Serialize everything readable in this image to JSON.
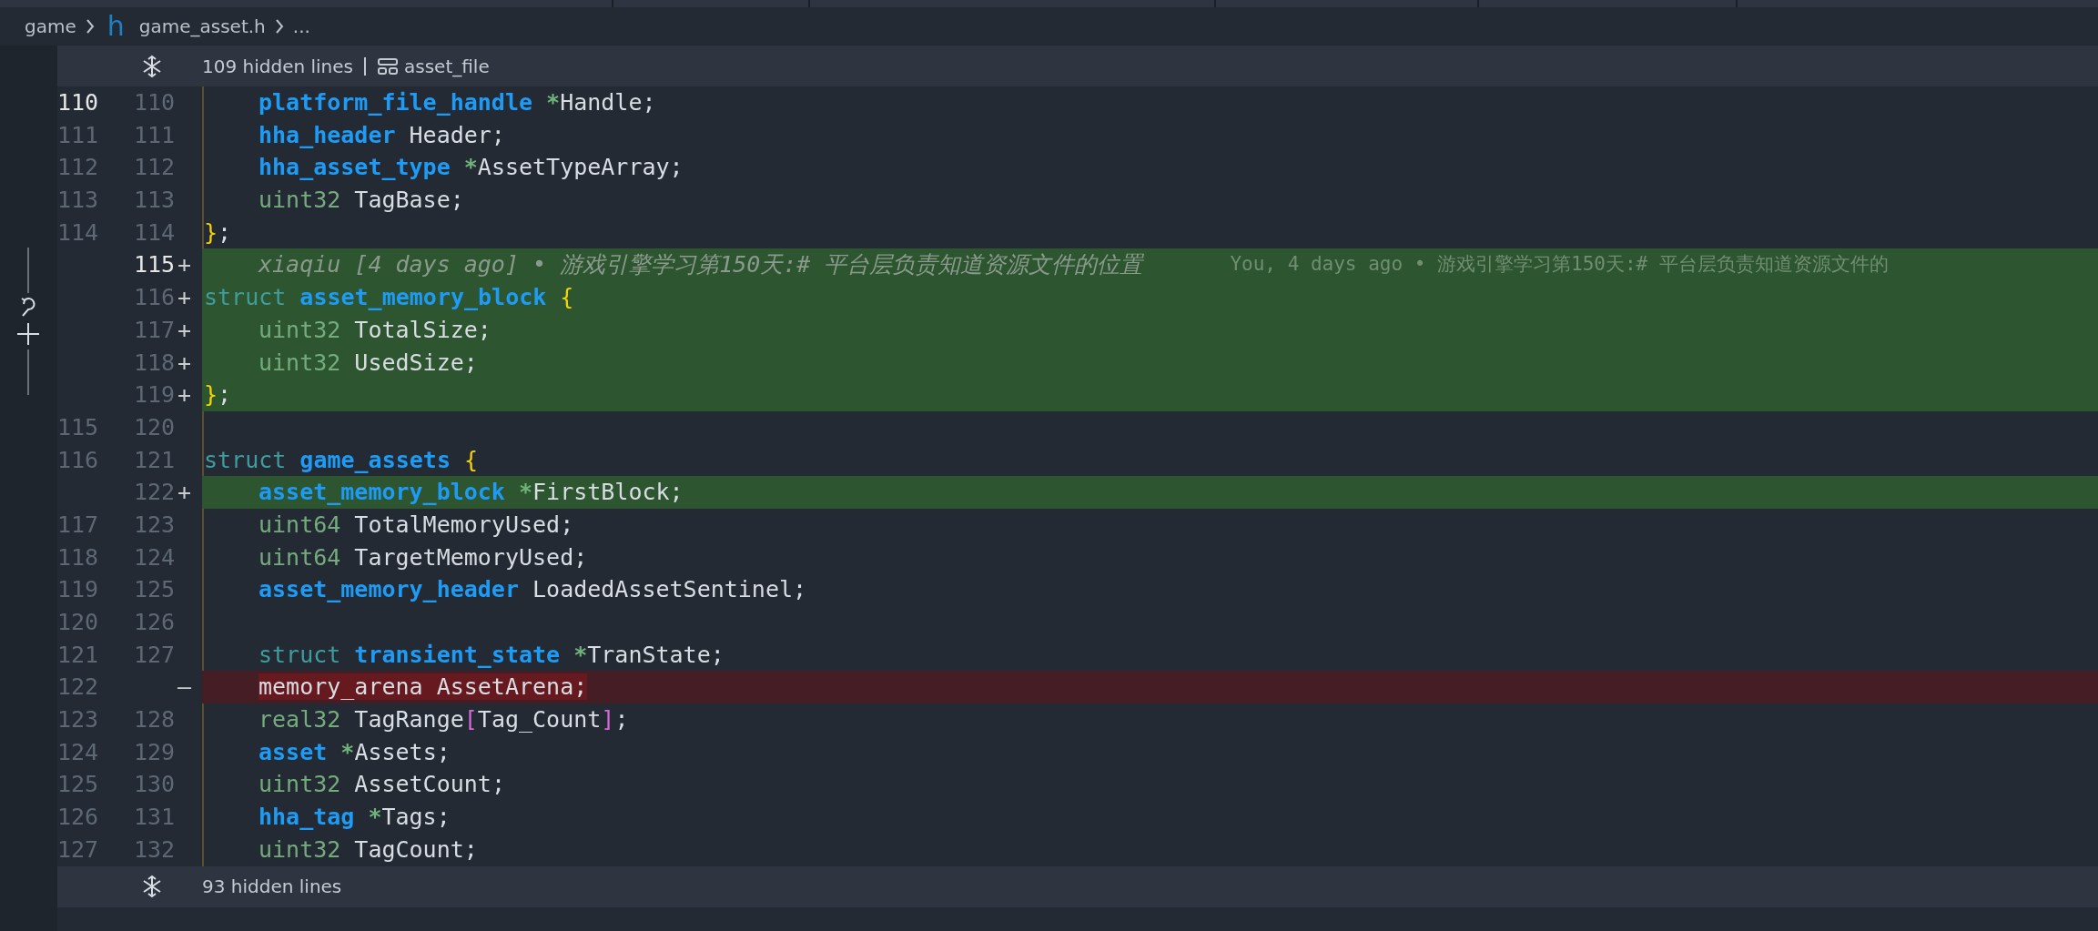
{
  "breadcrumb": {
    "folder": "game",
    "file_icon": "h",
    "file": "game_asset.h",
    "more": "..."
  },
  "top_fold": {
    "label": "109 hidden lines",
    "symbol": "asset_file"
  },
  "rows": [
    {
      "kind": "context",
      "old": "110",
      "new": "110",
      "current": true,
      "indented": true,
      "tokens": [
        {
          "kind": "ty",
          "t": "platform_file_handle"
        },
        {
          "kind": "ptr",
          "t": " *"
        },
        {
          "kind": "id",
          "t": "Handle;"
        }
      ]
    },
    {
      "kind": "context",
      "old": "111",
      "new": "111",
      "indented": true,
      "tokens": [
        {
          "kind": "ty",
          "t": "hha_header"
        },
        {
          "kind": "id",
          "t": " Header;"
        }
      ]
    },
    {
      "kind": "context",
      "old": "112",
      "new": "112",
      "indented": true,
      "tokens": [
        {
          "kind": "ty",
          "t": "hha_asset_type"
        },
        {
          "kind": "ptr",
          "t": " *"
        },
        {
          "kind": "id",
          "t": "AssetTypeArray;"
        }
      ]
    },
    {
      "kind": "context",
      "old": "113",
      "new": "113",
      "indented": true,
      "tokens": [
        {
          "kind": "prim",
          "t": "uint32"
        },
        {
          "kind": "id",
          "t": " TagBase;"
        }
      ]
    },
    {
      "kind": "context",
      "old": "114",
      "new": "114",
      "indented": false,
      "tokens": [
        {
          "kind": "brace",
          "t": "}"
        },
        {
          "kind": "id",
          "t": ";"
        }
      ]
    },
    {
      "kind": "added",
      "new": "115",
      "marker": "+",
      "current": true,
      "indented": true,
      "annotation": "xiaqiu [4 days ago] • 游戏引擎学习第150天:# 平台层负责知道资源文件的位置",
      "blame": "You, 4 days ago • 游戏引擎学习第150天:# 平台层负责知道资源文件的"
    },
    {
      "kind": "added",
      "new": "116",
      "marker": "+",
      "indented": false,
      "tokens": [
        {
          "kind": "kw",
          "t": "struct"
        },
        {
          "kind": "ty",
          "t": " asset_memory_block"
        },
        {
          "kind": "brace",
          "t": " {"
        }
      ]
    },
    {
      "kind": "added",
      "new": "117",
      "marker": "+",
      "indented": true,
      "tokens": [
        {
          "kind": "prim",
          "t": "uint32"
        },
        {
          "kind": "id",
          "t": " TotalSize;"
        }
      ]
    },
    {
      "kind": "added",
      "new": "118",
      "marker": "+",
      "indented": true,
      "tokens": [
        {
          "kind": "prim",
          "t": "uint32"
        },
        {
          "kind": "id",
          "t": " UsedSize;"
        }
      ]
    },
    {
      "kind": "added",
      "new": "119",
      "marker": "+",
      "indented": false,
      "tokens": [
        {
          "kind": "brace",
          "t": "}"
        },
        {
          "kind": "id",
          "t": ";"
        }
      ]
    },
    {
      "kind": "context",
      "old": "115",
      "new": "120"
    },
    {
      "kind": "context",
      "old": "116",
      "new": "121",
      "indented": false,
      "tokens": [
        {
          "kind": "kw",
          "t": "struct"
        },
        {
          "kind": "ty",
          "t": " game_assets"
        },
        {
          "kind": "brace",
          "t": " {"
        }
      ]
    },
    {
      "kind": "added",
      "new": "122",
      "marker": "+",
      "indented": true,
      "tokens": [
        {
          "kind": "ty",
          "t": "asset_memory_block"
        },
        {
          "kind": "ptr",
          "t": " *"
        },
        {
          "kind": "id",
          "t": "FirstBlock;"
        }
      ]
    },
    {
      "kind": "context",
      "old": "117",
      "new": "123",
      "indented": true,
      "tokens": [
        {
          "kind": "prim",
          "t": "uint64"
        },
        {
          "kind": "id",
          "t": " TotalMemoryUsed;"
        }
      ]
    },
    {
      "kind": "context",
      "old": "118",
      "new": "124",
      "indented": true,
      "tokens": [
        {
          "kind": "prim",
          "t": "uint64"
        },
        {
          "kind": "id",
          "t": " TargetMemoryUsed;"
        }
      ]
    },
    {
      "kind": "context",
      "old": "119",
      "new": "125",
      "indented": true,
      "tokens": [
        {
          "kind": "ty",
          "t": "asset_memory_header"
        },
        {
          "kind": "id",
          "t": " LoadedAssetSentinel;"
        }
      ]
    },
    {
      "kind": "context",
      "old": "120",
      "new": "126"
    },
    {
      "kind": "context",
      "old": "121",
      "new": "127",
      "indented": true,
      "tokens": [
        {
          "kind": "kw",
          "t": "struct"
        },
        {
          "kind": "ty",
          "t": " transient_state"
        },
        {
          "kind": "ptr",
          "t": " *"
        },
        {
          "kind": "id",
          "t": "TranState;"
        }
      ]
    },
    {
      "kind": "removed",
      "old": "122",
      "marker": "—",
      "indented": true,
      "tokens": [
        {
          "kind": "id",
          "t": "memory_arena AssetArena;"
        }
      ]
    },
    {
      "kind": "context",
      "old": "123",
      "new": "128",
      "indented": true,
      "tokens": [
        {
          "kind": "prim",
          "t": "real32"
        },
        {
          "kind": "id",
          "t": " TagRange"
        },
        {
          "kind": "bracket",
          "t": "["
        },
        {
          "kind": "id",
          "t": "Tag_Count"
        },
        {
          "kind": "bracket",
          "t": "]"
        },
        {
          "kind": "id",
          "t": ";"
        }
      ]
    },
    {
      "kind": "context",
      "old": "124",
      "new": "129",
      "indented": true,
      "tokens": [
        {
          "kind": "ty",
          "t": "asset"
        },
        {
          "kind": "ptr",
          "t": " *"
        },
        {
          "kind": "id",
          "t": "Assets;"
        }
      ]
    },
    {
      "kind": "context",
      "old": "125",
      "new": "130",
      "indented": true,
      "tokens": [
        {
          "kind": "prim",
          "t": "uint32"
        },
        {
          "kind": "id",
          "t": " AssetCount;"
        }
      ]
    },
    {
      "kind": "context",
      "old": "126",
      "new": "131",
      "indented": true,
      "tokens": [
        {
          "kind": "ty",
          "t": "hha_tag"
        },
        {
          "kind": "ptr",
          "t": " *"
        },
        {
          "kind": "id",
          "t": "Tags;"
        }
      ]
    },
    {
      "kind": "context",
      "old": "127",
      "new": "132",
      "indented": true,
      "tokens": [
        {
          "kind": "prim",
          "t": "uint32"
        },
        {
          "kind": "id",
          "t": " TagCount;"
        }
      ]
    }
  ],
  "bottom_fold": {
    "label": "93 hidden lines"
  }
}
